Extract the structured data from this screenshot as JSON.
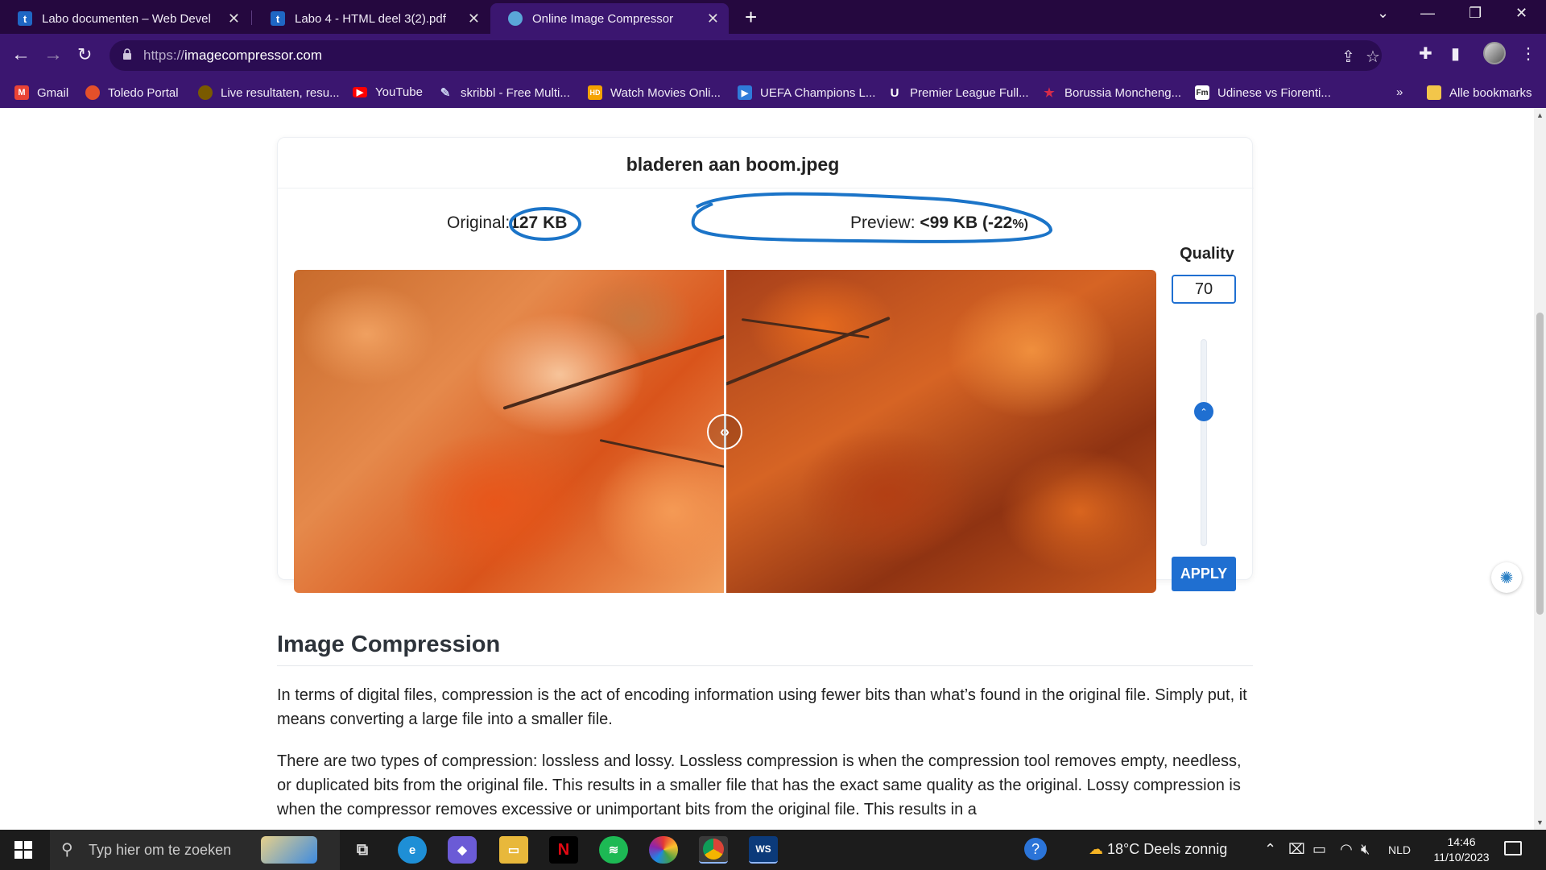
{
  "browser": {
    "tabs": [
      {
        "title": "Labo documenten – Web Develo",
        "favicon": "t",
        "active": false
      },
      {
        "title": "Labo 4 - HTML deel 3(2).pdf",
        "favicon": "t",
        "active": false
      },
      {
        "title": "Online Image Compressor",
        "favicon": "cloud-icon",
        "active": true
      }
    ],
    "new_tab": "+",
    "url_scheme": "https://",
    "url_host": "imagecompressor.com",
    "bookmarks": [
      {
        "label": "Gmail",
        "icon": "gmail-icon",
        "color": "#ea4335"
      },
      {
        "label": "Toledo Portal",
        "icon": "toledo-icon",
        "color": "#e4502a"
      },
      {
        "label": "Live resultaten, resu...",
        "icon": "livescore-icon",
        "color": "#7a5a00"
      },
      {
        "label": "YouTube",
        "icon": "youtube-icon",
        "color": "#ff0000"
      },
      {
        "label": "skribbl - Free Multi...",
        "icon": "pencil-icon",
        "color": "#9aa4d8"
      },
      {
        "label": "Watch Movies Onli...",
        "icon": "hd-icon",
        "color": "#f5a300"
      },
      {
        "label": "UEFA Champions L...",
        "icon": "play-icon",
        "color": "#2f7bd9"
      },
      {
        "label": "Premier League Full...",
        "icon": "u-icon",
        "color": "#1b1b4d"
      },
      {
        "label": "Borussia Moncheng...",
        "icon": "star-icon",
        "color": "#d62b4a"
      },
      {
        "label": "Udinese vs Fiorenti...",
        "icon": "fm-icon",
        "color": "#222222"
      }
    ],
    "bookmarks_overflow": "»",
    "all_bookmarks": "Alle bookmarks"
  },
  "compressor": {
    "filename": "bladeren aan boom.jpeg",
    "original_label": "Original:",
    "original_size": "127 KB",
    "preview_label": "Preview:",
    "preview_size": "<99 KB (-22",
    "preview_pct": "%)",
    "quality_title": "Quality",
    "quality_value": "70",
    "quality_level": 0.7,
    "apply_label": "APPLY",
    "accent_color": "#1f6fd1"
  },
  "article": {
    "heading": "Image Compression",
    "paragraphs": [
      "In terms of digital files, compression is the act of encoding information using fewer bits than what’s found in the original file. Simply put, it means converting a large file into a smaller file.",
      "There are two types of compression: lossless and lossy. Lossless compression is when the compression tool removes empty, needless, or duplicated bits from the original file. This results in a smaller file that has the exact same quality as the original. Lossy compression is when the compressor removes excessive or unimportant bits from the original file. This results in a"
    ]
  },
  "taskbar": {
    "search_placeholder": "Typ hier om te zoeken",
    "weather": "18°C  Deels zonnig",
    "language": "NLD",
    "time": "14:46",
    "date": "11/10/2023",
    "apps": [
      "edge-icon",
      "copilot-icon",
      "explorer-icon",
      "netflix-icon",
      "spotify-icon",
      "photos-icon",
      "chrome-icon",
      "webstorm-icon"
    ]
  }
}
